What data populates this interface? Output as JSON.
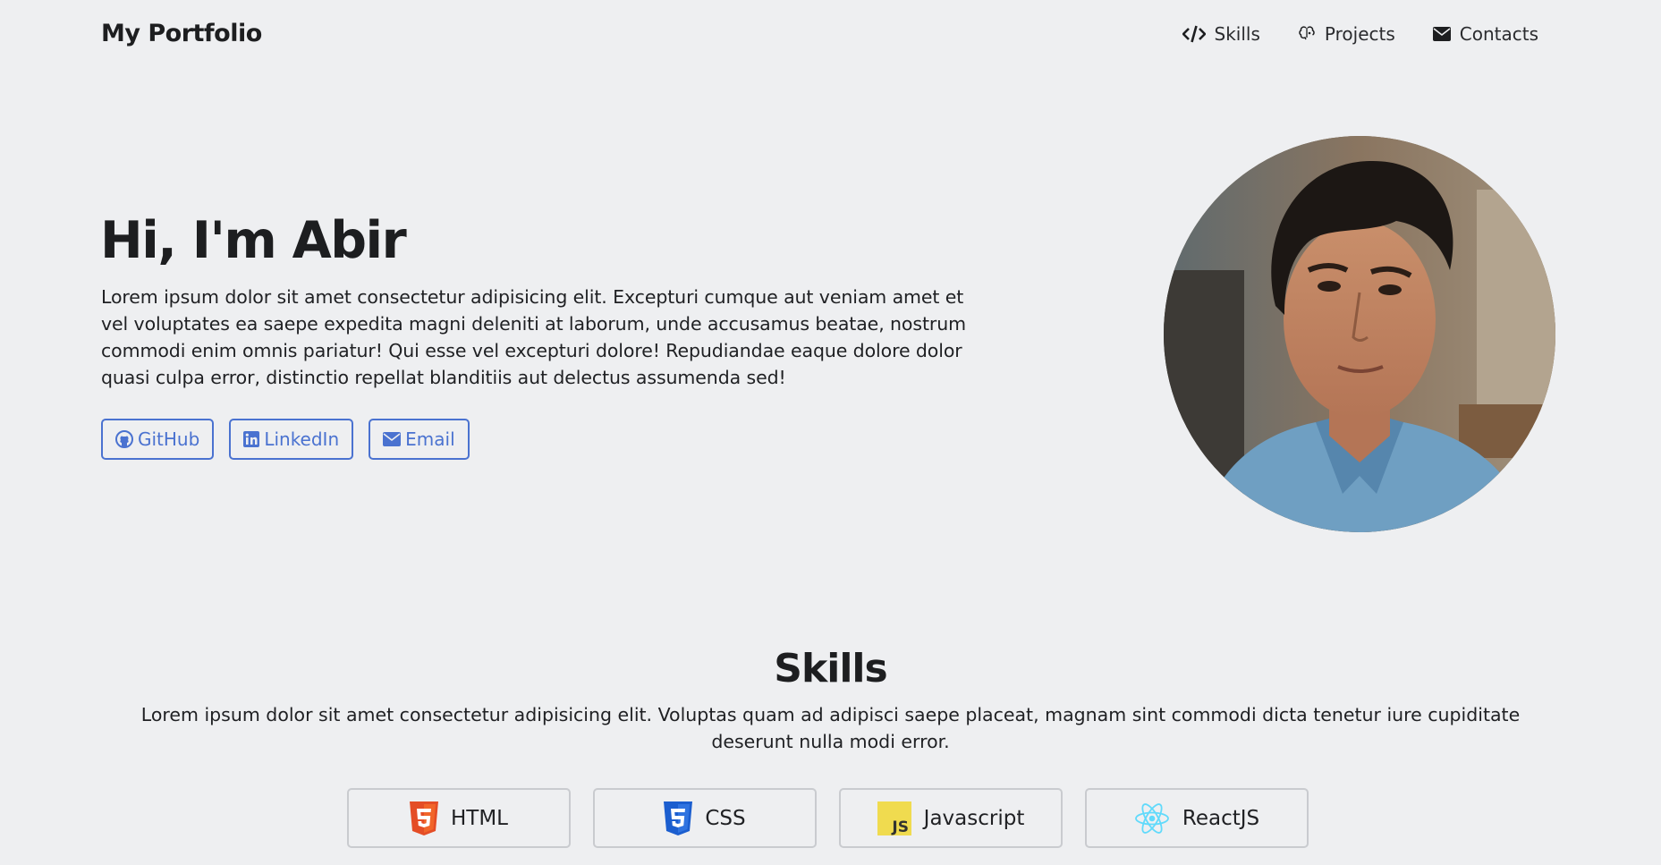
{
  "brand": "My Portfolio",
  "nav": {
    "items": [
      {
        "label": "Skills",
        "icon": "code-icon"
      },
      {
        "label": "Projects",
        "icon": "brain-icon"
      },
      {
        "label": "Contacts",
        "icon": "envelope-icon"
      }
    ]
  },
  "hero": {
    "title": "Hi, I'm Abir",
    "description": "Lorem ipsum dolor sit amet consectetur adipisicing elit. Excepturi cumque aut veniam amet et vel voluptates ea saepe expedita magni deleniti at laborum, unde accusamus beatae, nostrum commodi enim omnis pariatur! Qui esse vel excepturi dolore! Repudiandae eaque dolore dolor quasi culpa error, distinctio repellat blanditiis aut delectus assumenda sed!",
    "buttons": [
      {
        "label": "GitHub",
        "icon": "github-icon"
      },
      {
        "label": "LinkedIn",
        "icon": "linkedin-icon"
      },
      {
        "label": "Email",
        "icon": "envelope-icon"
      }
    ]
  },
  "skills": {
    "title": "Skills",
    "description": "Lorem ipsum dolor sit amet consectetur adipisicing elit. Voluptas quam ad adipisci saepe placeat, magnam sint commodi dicta tenetur iure cupiditate deserunt nulla modi error.",
    "items": [
      {
        "label": "HTML",
        "icon": "html5-icon"
      },
      {
        "label": "CSS",
        "icon": "css3-icon"
      },
      {
        "label": "Javascript",
        "icon": "js-icon"
      },
      {
        "label": "ReactJS",
        "icon": "react-icon"
      }
    ]
  },
  "colors": {
    "background": "#eeeff1",
    "accent": "#4a72d0",
    "text": "#1d1e20",
    "card_border": "#c9cbcf"
  }
}
